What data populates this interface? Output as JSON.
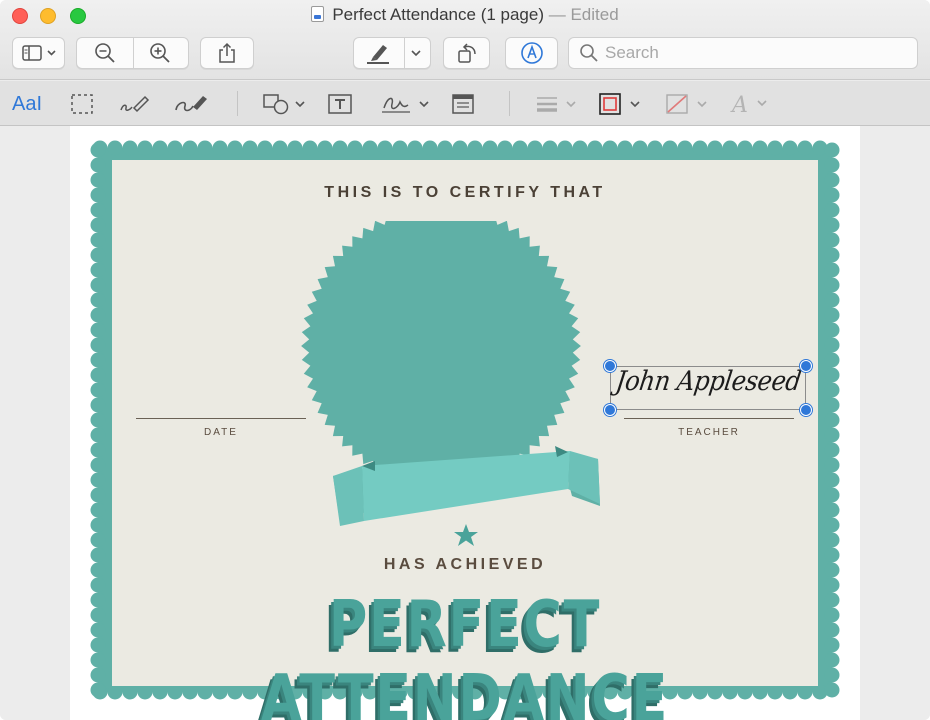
{
  "window": {
    "title": "Perfect Attendance (1 page)",
    "status": "— Edited"
  },
  "toolbar": {
    "sidebar_button": "sidebar-icon",
    "zoom_out": "zoom-out-icon",
    "zoom_in": "zoom-in-icon",
    "share": "share-icon",
    "highlight": "highlighter-icon",
    "rotate": "rotate-icon",
    "markup": "markup-icon",
    "search": {
      "placeholder": "Search",
      "value": ""
    }
  },
  "markup_toolbar": {
    "text_selection_label": "AaI",
    "tools": [
      "text-selection",
      "rectangular-selection",
      "sketch",
      "draw",
      "shapes",
      "text",
      "sign",
      "note",
      "shape-style",
      "border-color",
      "fill-color",
      "text-style"
    ]
  },
  "certificate": {
    "heading": "THIS IS TO CERTIFY THAT",
    "date_label": "DATE",
    "teacher_label": "TEACHER",
    "signature": "John Appleseed",
    "achieved": "HAS ACHIEVED",
    "award": "PERFECT ATTENDANCE"
  },
  "colors": {
    "teal": "#5fb0a6",
    "teal_dark": "#3d8a82",
    "teal_light": "#74cbc2",
    "paper": "#ebeae2",
    "text_brown": "#4b4136",
    "selection_blue": "#2f78d8"
  }
}
